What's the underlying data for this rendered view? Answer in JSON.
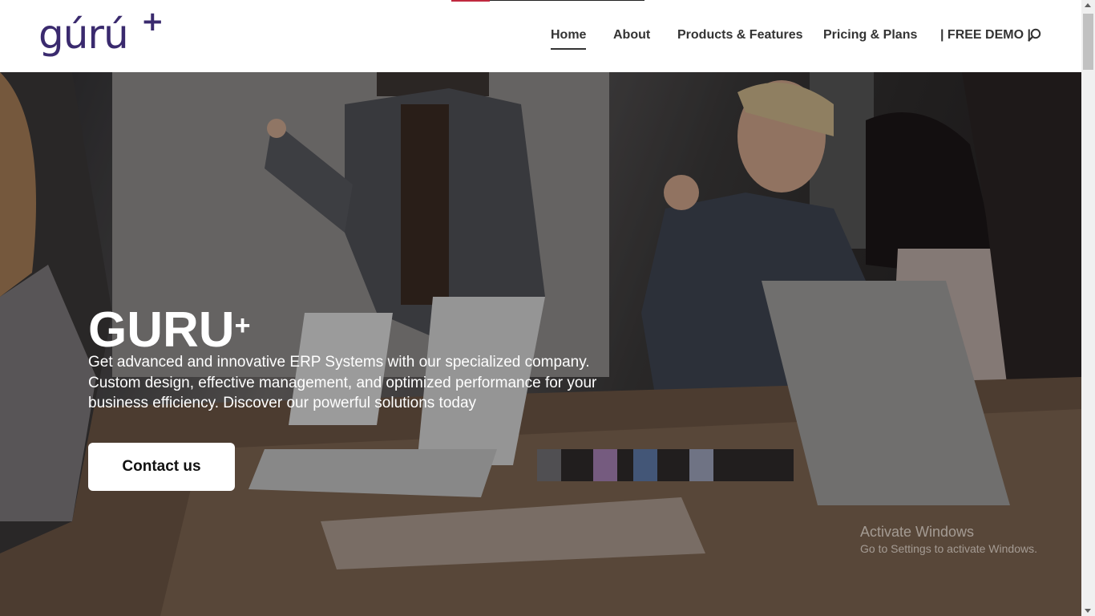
{
  "logo": {
    "text": "gúrú",
    "plus": "+",
    "color_primary": "#3a2a6e",
    "color_accent": "#b0263c"
  },
  "nav": {
    "items": [
      {
        "label": "Home",
        "active": true
      },
      {
        "label": "About",
        "active": false
      },
      {
        "label": "Products & Features",
        "active": false
      },
      {
        "label": "Pricing & Plans",
        "active": false
      },
      {
        "label": "| FREE DEMO |",
        "active": false
      }
    ],
    "search_icon": "search-icon"
  },
  "hero": {
    "title": "GURU",
    "title_plus": "+",
    "description_lines": [
      "Get advanced and innovative ERP Systems with our specialized company.",
      "Custom design, effective management, and optimized performance for your",
      "business efficiency. Discover our powerful solutions today"
    ],
    "cta_label": "Contact us"
  },
  "watermark": {
    "title": "Activate Windows",
    "subtitle": "Go to Settings to activate Windows."
  },
  "colors": {
    "header_bg": "#ffffff",
    "nav_text": "#333333",
    "button_bg": "#ffffff",
    "loader_accent": "#c0293f"
  }
}
